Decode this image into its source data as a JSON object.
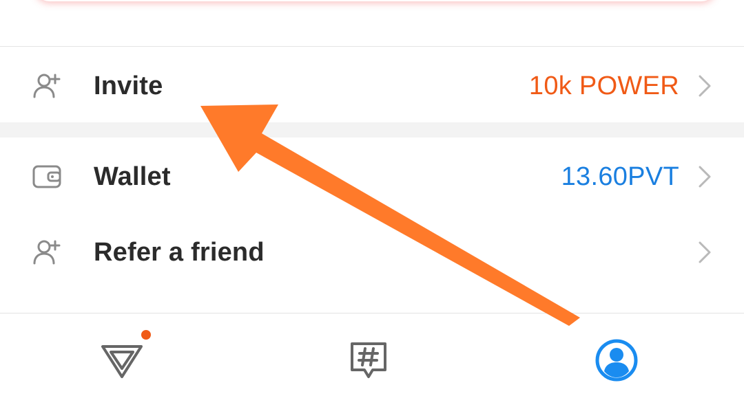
{
  "menu": {
    "items": [
      {
        "label": "Invite",
        "value": "10k POWER",
        "icon": "add-user-icon",
        "value_color": "#f05a16"
      },
      {
        "label": "Wallet",
        "value": "13.60PVT",
        "icon": "wallet-icon",
        "value_color": "#1a7fe0"
      },
      {
        "label": "Refer a friend",
        "value": "",
        "icon": "add-user-icon"
      }
    ]
  },
  "bottom_nav": {
    "items": [
      {
        "icon": "triangle-logo-icon",
        "has_notification": true,
        "notification_color": "#f05a16"
      },
      {
        "icon": "hashtag-chat-icon"
      },
      {
        "icon": "profile-icon",
        "active": true,
        "active_color": "#1a8cf0"
      }
    ]
  },
  "colors": {
    "annotation_arrow": "#ff7a2a",
    "label_text": "#2b2b2b",
    "icon_gray": "#8a8a8a"
  }
}
